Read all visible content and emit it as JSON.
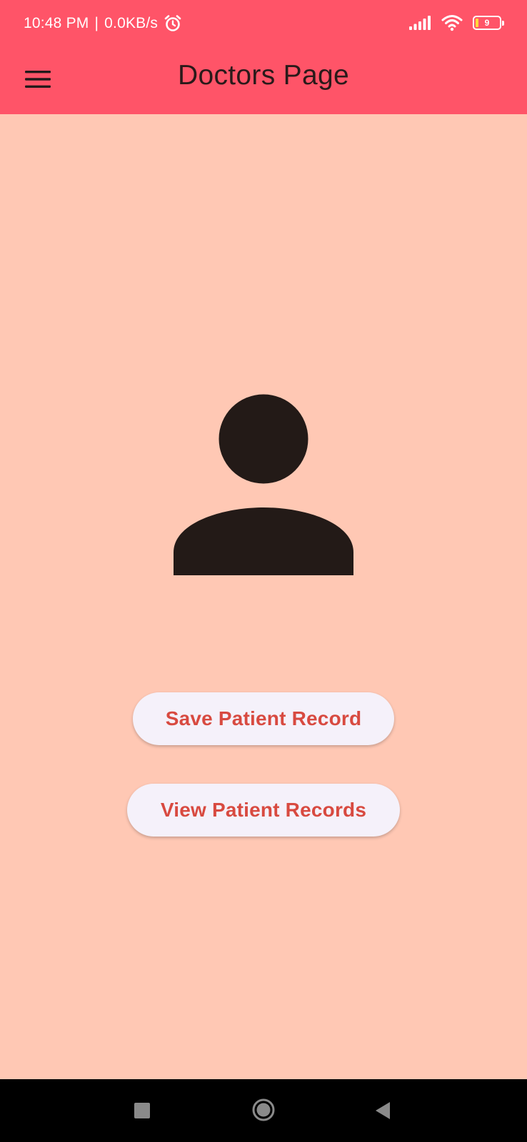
{
  "status_bar": {
    "time": "10:48 PM",
    "network_speed": "0.0KB/s",
    "separator": "|",
    "battery_level": "9",
    "icons": [
      "alarm-icon",
      "signal-icon",
      "wifi-icon",
      "battery-icon"
    ]
  },
  "app_bar": {
    "title": "Doctors Page",
    "menu_icon": "hamburger-menu-icon"
  },
  "main": {
    "avatar_icon": "person-icon",
    "buttons": [
      {
        "label": "Save Patient Record"
      },
      {
        "label": "View Patient Records"
      }
    ]
  },
  "nav_bar": {
    "icons": [
      "recents-icon",
      "home-icon",
      "back-icon"
    ]
  },
  "colors": {
    "app_bar": "#FF5468",
    "background": "#FFC8B4",
    "button_bg": "#F5F1FA",
    "button_text": "#D84A40",
    "icon_dark": "#231A17",
    "nav_bar": "#000000"
  }
}
